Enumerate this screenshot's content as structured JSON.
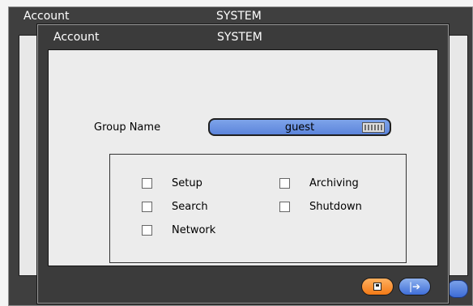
{
  "background_window": {
    "title": "Account",
    "subtitle": "SYSTEM",
    "nav_icon": "exit-arrow-icon"
  },
  "dialog": {
    "title": "Account",
    "subtitle": "SYSTEM",
    "group_name": {
      "label": "Group Name",
      "value": "guest",
      "icon": "keyboard-icon"
    },
    "permissions": [
      {
        "label": "Setup",
        "checked": false
      },
      {
        "label": "Archiving",
        "checked": false
      },
      {
        "label": "Search",
        "checked": false
      },
      {
        "label": "Shutdown",
        "checked": false
      },
      {
        "label": "Network",
        "checked": false
      }
    ],
    "buttons": {
      "save_icon": "save-icon",
      "exit_icon": "exit-arrow-icon",
      "exit_glyph": "|➔"
    }
  },
  "colors": {
    "window_bg": "#3b3b3b",
    "panel_bg": "#ececec",
    "input_blue": "#6a90e0",
    "save_orange": "#f47a16",
    "exit_blue": "#3f6ed8"
  }
}
